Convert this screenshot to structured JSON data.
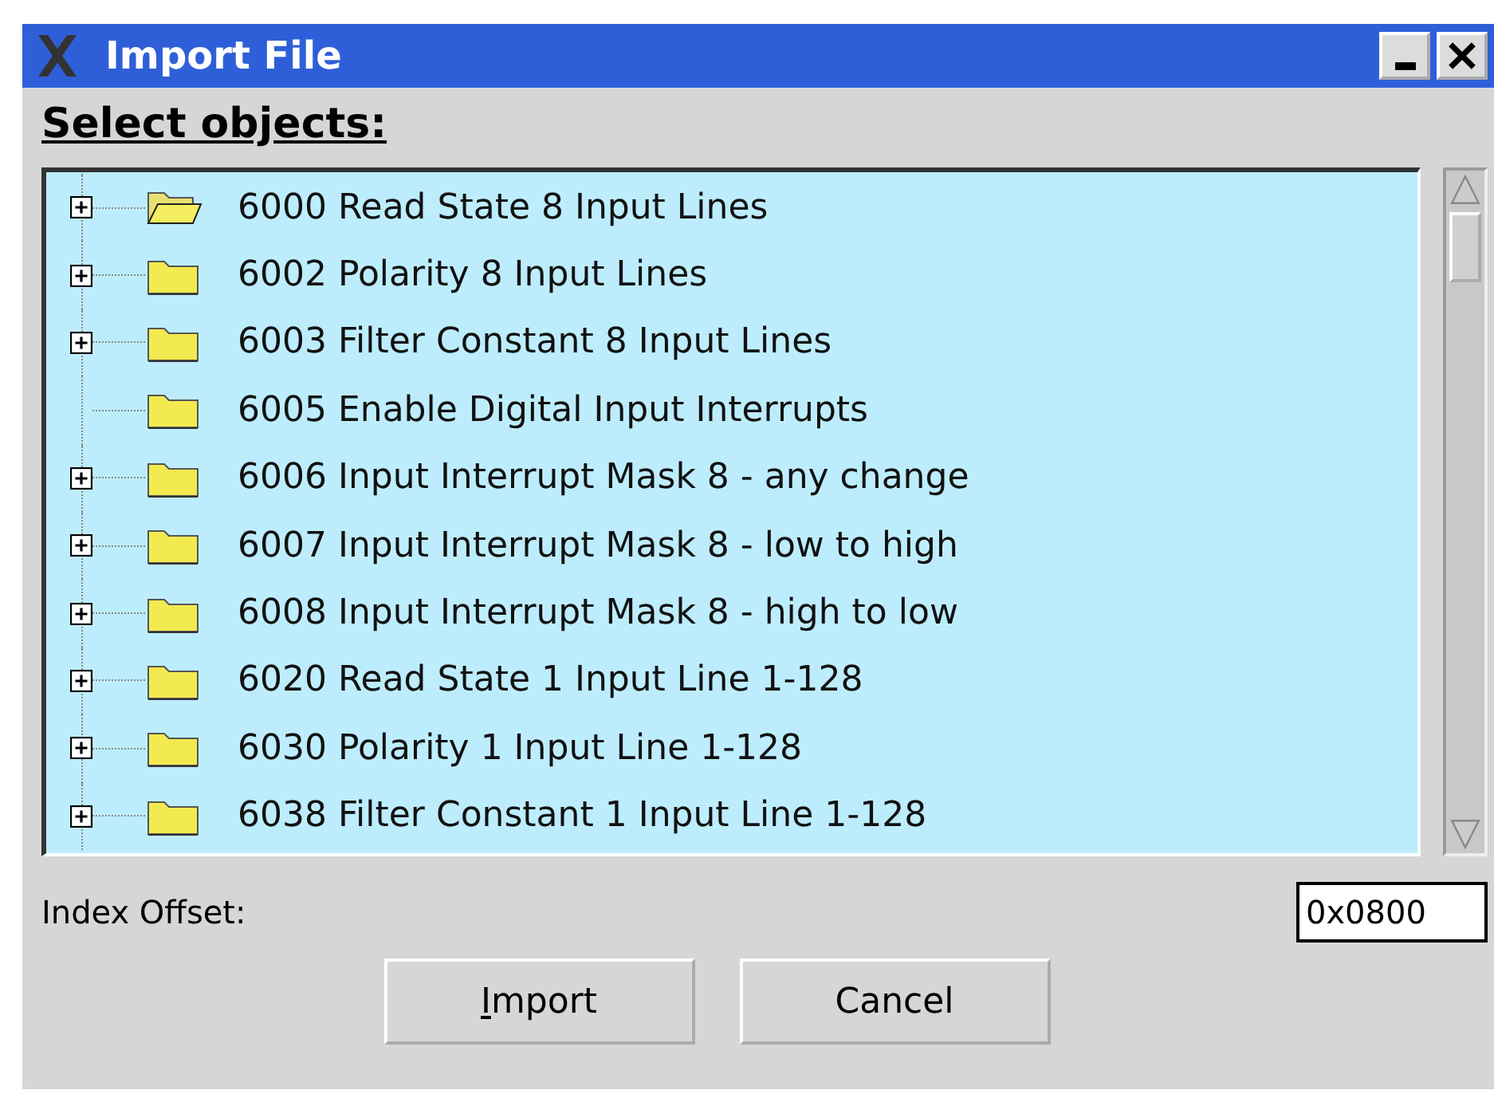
{
  "window": {
    "title": "Import File"
  },
  "heading": "Select objects:",
  "tree": {
    "items": [
      {
        "label": "6000 Read State 8 Input Lines",
        "expandable": true,
        "selected": true
      },
      {
        "label": "6002 Polarity 8 Input Lines",
        "expandable": true,
        "selected": false
      },
      {
        "label": "6003 Filter Constant 8 Input Lines",
        "expandable": true,
        "selected": false
      },
      {
        "label": "6005 Enable Digital Input Interrupts",
        "expandable": false,
        "selected": false
      },
      {
        "label": "6006 Input Interrupt Mask 8 - any change",
        "expandable": true,
        "selected": false
      },
      {
        "label": "6007 Input Interrupt Mask 8 - low to high",
        "expandable": true,
        "selected": false
      },
      {
        "label": "6008 Input Interrupt Mask 8 - high to low",
        "expandable": true,
        "selected": false
      },
      {
        "label": "6020 Read State 1 Input Line 1-128",
        "expandable": true,
        "selected": false
      },
      {
        "label": "6030 Polarity 1 Input Line 1-128",
        "expandable": true,
        "selected": false
      },
      {
        "label": "6038 Filter Constant 1 Input Line 1-128",
        "expandable": true,
        "selected": false
      }
    ]
  },
  "index_offset": {
    "label": "Index Offset:",
    "value": "0x0800"
  },
  "buttons": [
    {
      "label": "Import",
      "first_letter_underlined": true
    },
    {
      "label": "Cancel",
      "first_letter_underlined": false
    }
  ]
}
